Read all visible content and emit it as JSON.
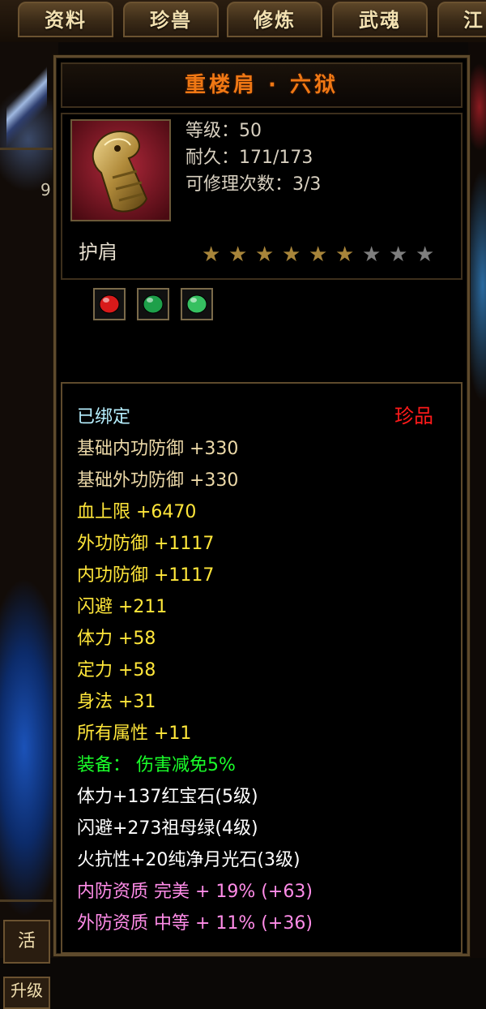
{
  "tabs": [
    {
      "label": "资料"
    },
    {
      "label": "珍兽"
    },
    {
      "label": "修炼"
    },
    {
      "label": "武魂"
    },
    {
      "label": "江"
    }
  ],
  "background": {
    "left_number": "9",
    "live_button": "活",
    "up_button": "升级"
  },
  "item": {
    "name": "重楼肩 · 六狱",
    "stats": [
      {
        "label": "等级：",
        "value": "50"
      },
      {
        "label": "耐久：",
        "value": "171/173"
      },
      {
        "label": "可修理次数：",
        "value": "3/3"
      }
    ],
    "type": "护肩",
    "stars_total": 9,
    "stars_filled": 6,
    "star_colors": {
      "filled": "#a8853a",
      "empty": "#7e7e7e"
    },
    "gems": [
      {
        "name": "ruby-gem-icon",
        "color": "#d81a1a"
      },
      {
        "name": "emerald-gem-icon",
        "color": "#1ea04a"
      },
      {
        "name": "moonstone-gem-icon",
        "color": "#36c060"
      }
    ],
    "rarity": "珍品",
    "attributes": [
      {
        "text": "已绑定",
        "style": "bound"
      },
      {
        "text": "基础内功防御  +330",
        "style": "base"
      },
      {
        "text": "基础外功防御  +330",
        "style": "base"
      },
      {
        "text": "血上限  +6470",
        "style": "attr"
      },
      {
        "text": "外功防御  +1117",
        "style": "attr"
      },
      {
        "text": "内功防御  +1117",
        "style": "attr"
      },
      {
        "text": "闪避  +211",
        "style": "attr"
      },
      {
        "text": "体力  +58",
        "style": "attr"
      },
      {
        "text": "定力  +58",
        "style": "attr"
      },
      {
        "text": "身法  +31",
        "style": "attr"
      },
      {
        "text": "所有属性  +11",
        "style": "attr"
      },
      {
        "text": "装备：  伤害减免5%",
        "style": "set"
      },
      {
        "text": "体力+137红宝石(5级)",
        "style": "gem"
      },
      {
        "text": "闪避+273祖母绿(4级)",
        "style": "gem"
      },
      {
        "text": "火抗性+20纯净月光石(3级)",
        "style": "gem"
      },
      {
        "text": "内防资质  完美  +  19% (+63)",
        "style": "qual"
      },
      {
        "text": "外防资质  中等  +  11% (+36)",
        "style": "qual"
      }
    ]
  },
  "colors": {
    "title": "#f07814",
    "rarity": "#ff1a1a",
    "bound": "#b7f0ff",
    "base": "#ecd9a8",
    "attr": "#ffe63a",
    "set": "#1aff2a",
    "gem": "#ffffff",
    "qual": "#ff8ce8"
  }
}
